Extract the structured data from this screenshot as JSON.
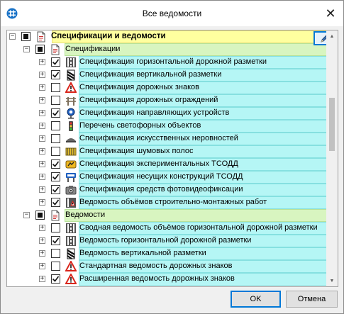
{
  "window": {
    "title": "Все ведомости"
  },
  "tree": {
    "root": {
      "label": "Спецификации и ведомости",
      "state": "partial",
      "expanded": true
    },
    "groups": [
      {
        "label": "Спецификации",
        "state": "partial",
        "expanded": true,
        "items": [
          {
            "label": "Спецификация горизонтальной дорожной разметки",
            "checked": true,
            "icon": "horizontal-marking-icon"
          },
          {
            "label": "Спецификация вертикальной разметки",
            "checked": true,
            "icon": "vertical-marking-icon"
          },
          {
            "label": "Спецификация дорожных знаков",
            "checked": false,
            "icon": "warning-sign-icon"
          },
          {
            "label": "Спецификация дорожных ограждений",
            "checked": false,
            "icon": "barrier-icon"
          },
          {
            "label": "Спецификация направляющих устройств",
            "checked": true,
            "icon": "guide-device-icon"
          },
          {
            "label": "Перечень светофорных объектов",
            "checked": false,
            "icon": "traffic-light-icon"
          },
          {
            "label": "Спецификация искусственных неровностей",
            "checked": false,
            "icon": "speed-bump-icon"
          },
          {
            "label": "Спецификация шумовых полос",
            "checked": false,
            "icon": "rumble-strip-icon"
          },
          {
            "label": "Спецификация экспериментальных ТСОДД",
            "checked": true,
            "icon": "experimental-tsodd-icon"
          },
          {
            "label": "Спецификация несущих конструкций ТСОДД",
            "checked": true,
            "icon": "support-structure-icon"
          },
          {
            "label": "Спецификация средств фотовидеофиксации",
            "checked": true,
            "icon": "camera-icon"
          },
          {
            "label": "Ведомость объёмов строительно-монтажных работ",
            "checked": true,
            "icon": "construction-works-icon"
          }
        ]
      },
      {
        "label": "Ведомости",
        "state": "partial",
        "expanded": true,
        "items": [
          {
            "label": "Сводная ведомость объёмов горизонтальной дорожной разметки",
            "checked": false,
            "icon": "horizontal-marking-icon"
          },
          {
            "label": "Ведомость горизонтальной дорожной разметки",
            "checked": true,
            "icon": "horizontal-marking-icon"
          },
          {
            "label": "Ведомость вертикальной разметки",
            "checked": false,
            "icon": "vertical-marking-icon"
          },
          {
            "label": "Стандартная ведомость дорожных знаков",
            "checked": false,
            "icon": "warning-sign-icon"
          },
          {
            "label": "Расширенная ведомость дорожных знаков",
            "checked": true,
            "icon": "warning-sign-icon"
          }
        ]
      }
    ]
  },
  "buttons": {
    "ok": "OK",
    "cancel": "Отмена"
  },
  "colors": {
    "root_highlight": "#ffff9f",
    "group_highlight": "#d8f5c0",
    "item_highlight": "#b5f6f5",
    "accent": "#0078d7"
  }
}
